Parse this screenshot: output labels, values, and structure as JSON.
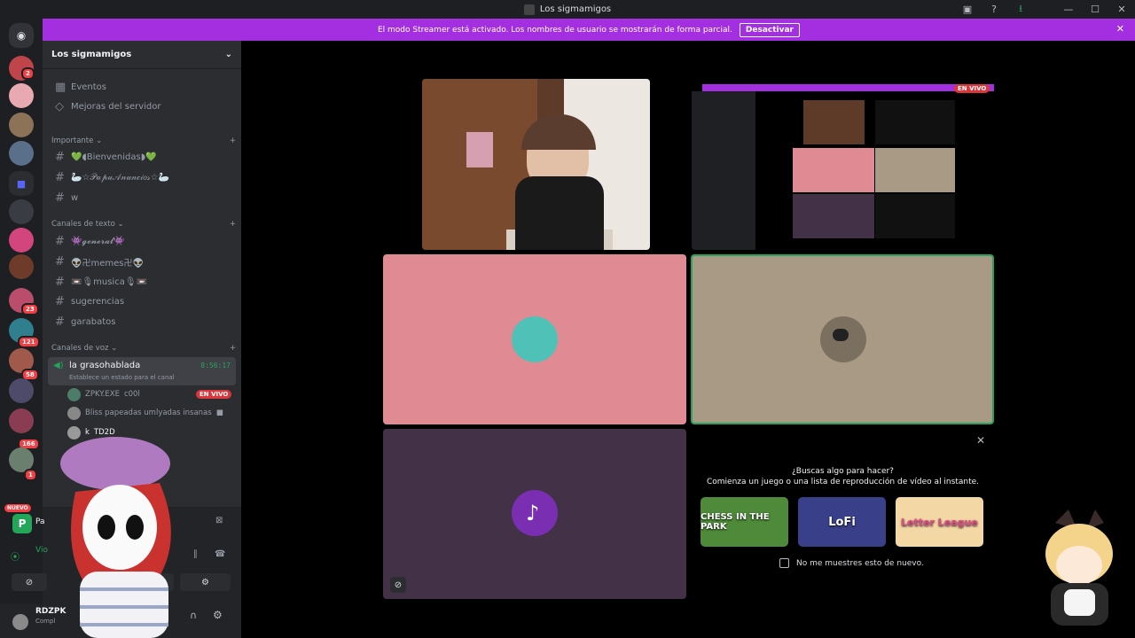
{
  "window": {
    "title": "Los sigmamigos"
  },
  "banner": {
    "text": "El modo Streamer está activado. Los nombres de usuario se mostrarán de forma parcial.",
    "button": "Desactivar"
  },
  "guilds": {
    "badges": [
      "2",
      "23",
      "121",
      "58",
      "166",
      "1"
    ],
    "nuevo": "NUEVO"
  },
  "sidebar": {
    "server_name": "Los sigmamigos",
    "top_items": [
      "Eventos",
      "Mejoras del servidor"
    ],
    "categories": {
      "importante": "Importante",
      "texto": "Canales de texto",
      "voz": "Canales de voz"
    },
    "importante_channels": [
      "💚◖Bienvenidas◗💚",
      "🦢☆𝒫𝒶𝓅𝓊𝒜𝓃𝓊𝓃𝒸𝒾𝑜𝓈☆🦢",
      "w"
    ],
    "text_channels": [
      "👾𝓰𝓮𝓷𝓮𝓻𝓪𝓵👾",
      "👽卍memes卍👽",
      "📼🎙musica🎙📼",
      "sugerencias",
      "garabatos"
    ],
    "voice_channel": {
      "name": "la grasohablada",
      "time": "8:56:17",
      "status": "Establece un estado para el canal"
    },
    "voice_users": [
      {
        "name": "ZPKY.EXE",
        "extra": "c00l",
        "live": "EN VIVO"
      },
      {
        "name": "Bliss papeadas umlyadas insanas",
        "extra": "",
        "live": ""
      },
      {
        "name": "k",
        "extra": "TD2D",
        "live": ""
      }
    ],
    "activity_user": "Pa",
    "voice_status": "Vio",
    "user": {
      "name": "RDZPK",
      "status": "Compl"
    }
  },
  "stage": {
    "preview_live": "EN VIVO",
    "activity": {
      "title": "¿Buscas algo para hacer?",
      "subtitle": "Comienza un juego o una lista de reproducción de vídeo al instante.",
      "games": [
        "CHESS IN THE PARK",
        "LoFi",
        "Letter League"
      ],
      "checkbox": "No me muestres esto de nuevo."
    }
  },
  "colors": {
    "banner": "#a32fe0",
    "tile_pink": "#e08a93",
    "tile_tan": "#a89a85",
    "tile_purple": "#433247",
    "speaking_border": "#23a55a"
  }
}
